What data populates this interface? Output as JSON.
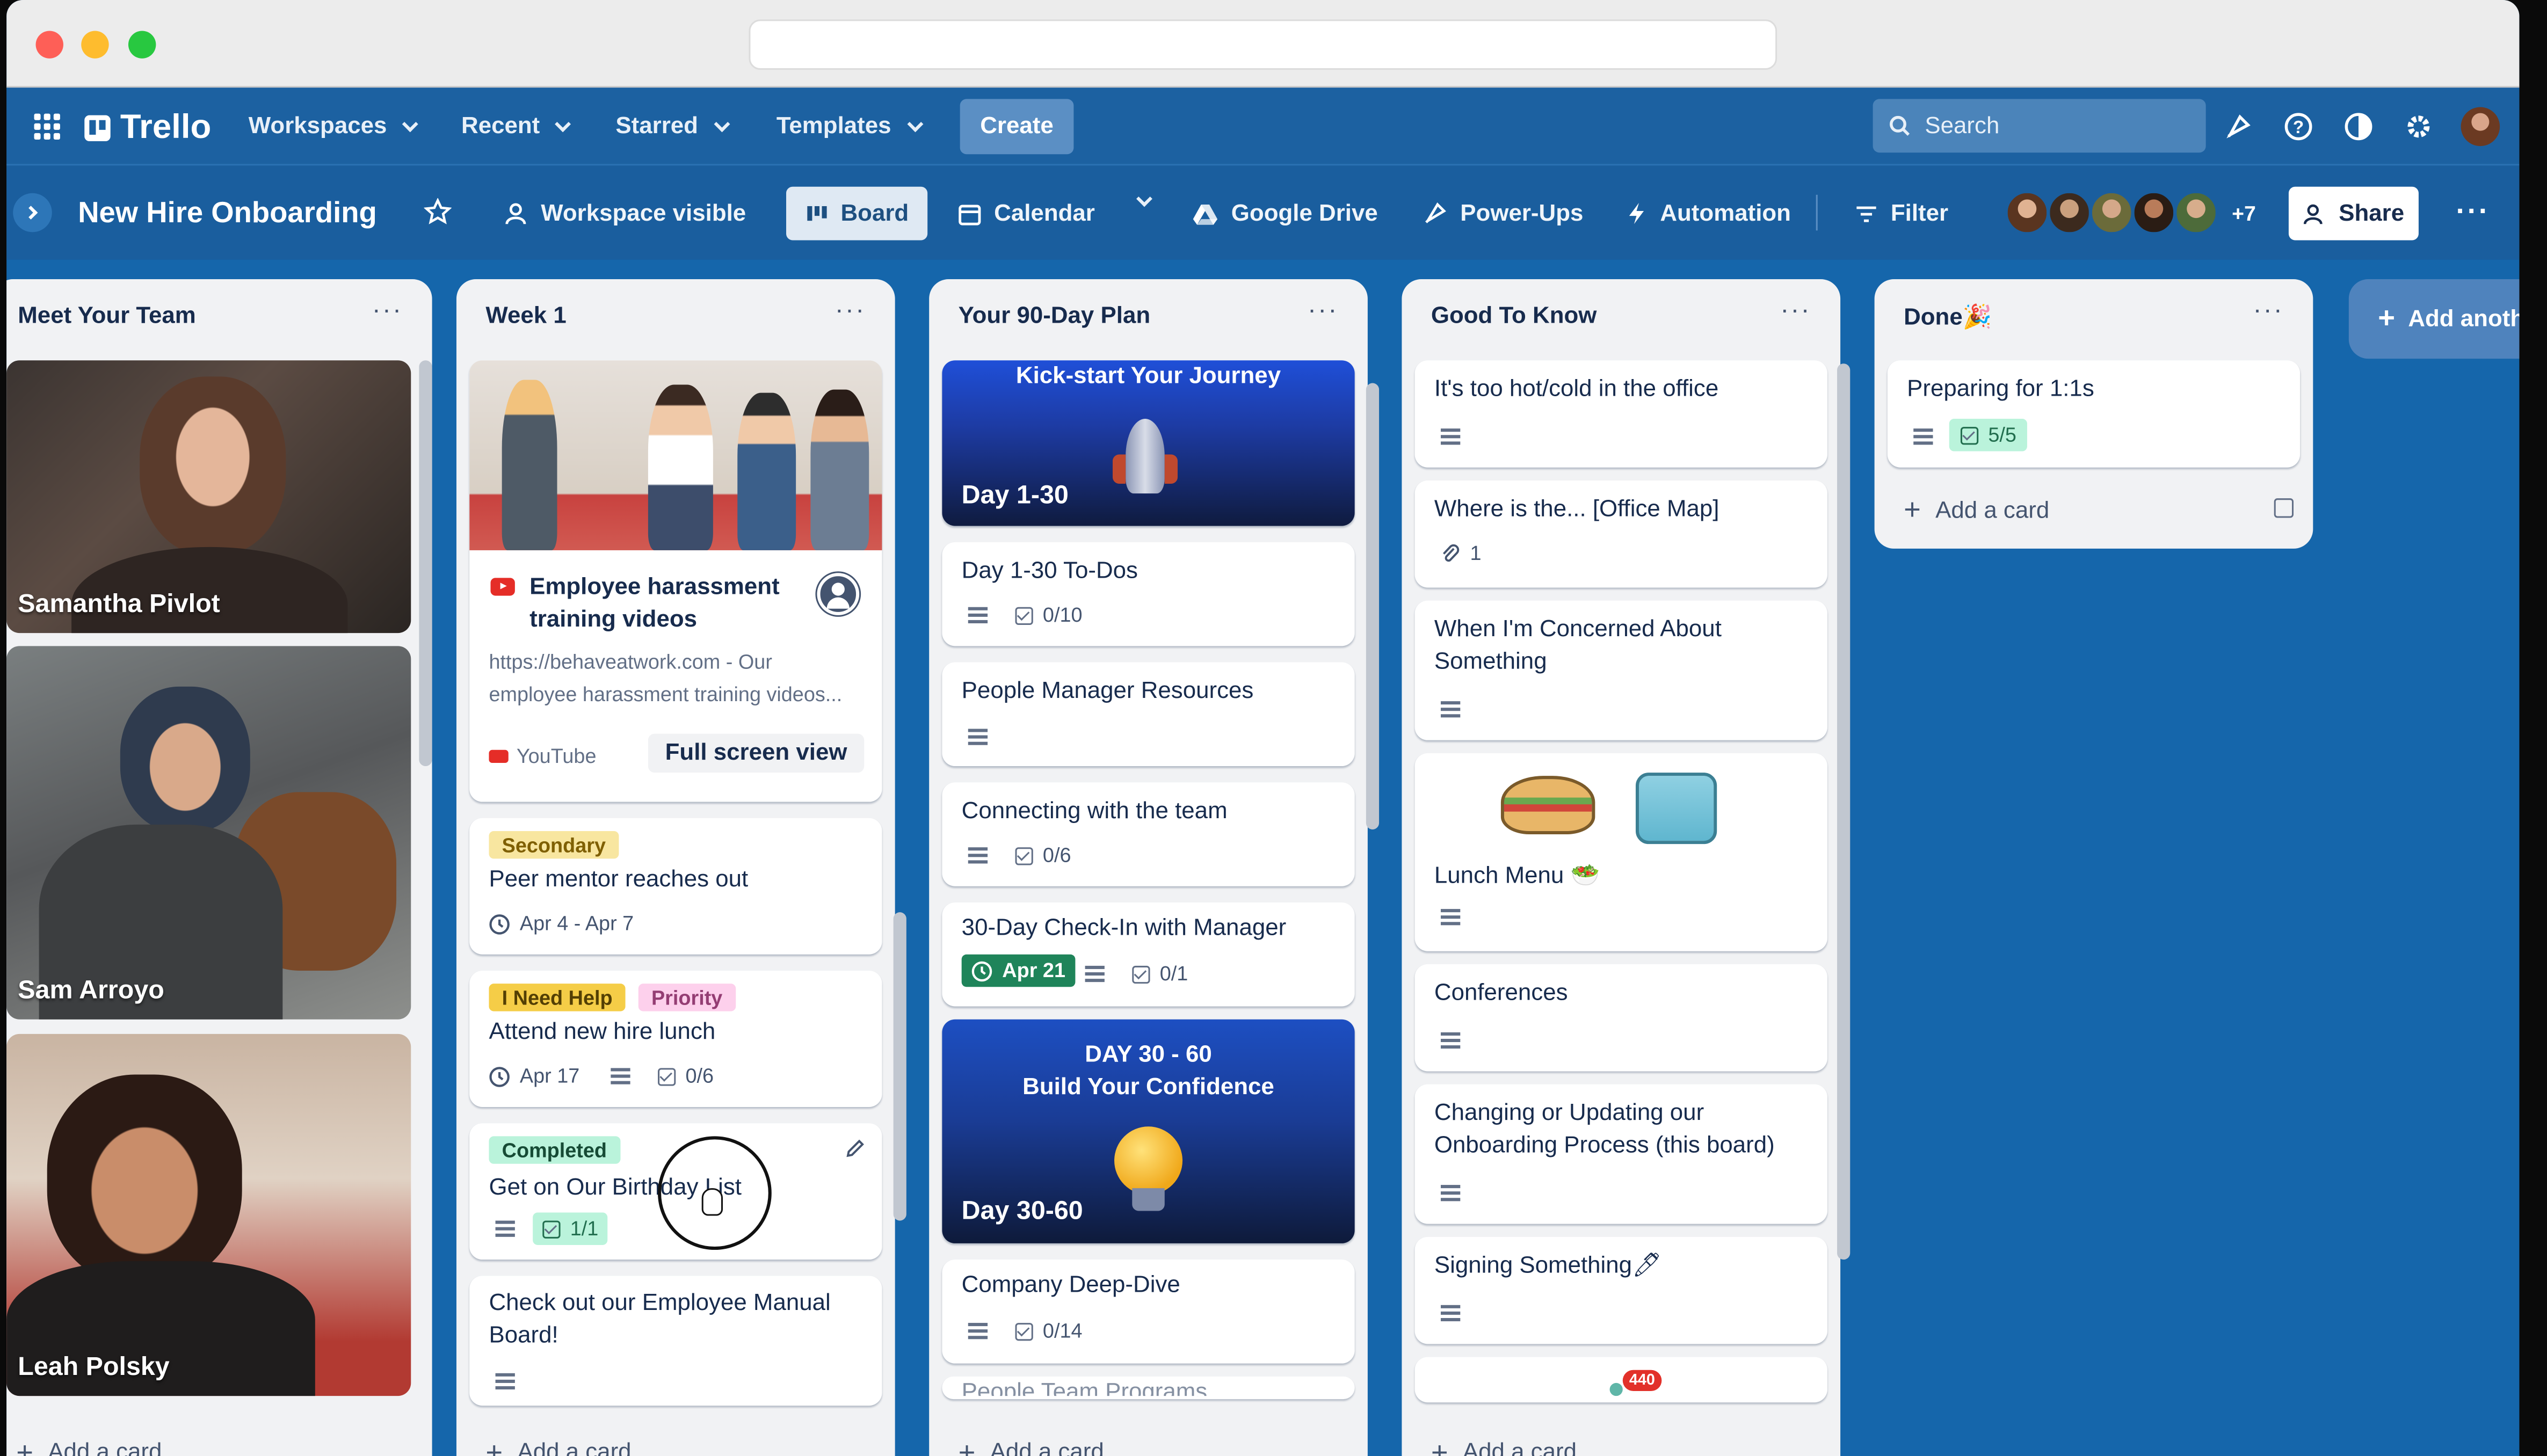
{
  "nav": {
    "brand": "Trello",
    "menus": [
      "Workspaces",
      "Recent",
      "Starred",
      "Templates"
    ],
    "create": "Create",
    "search_placeholder": "Search"
  },
  "board": {
    "title": "New Hire Onboarding",
    "visibility": "Workspace visible",
    "views": [
      "Board",
      "Calendar"
    ],
    "powerups": [
      "Google Drive",
      "Power-Ups",
      "Automation"
    ],
    "filter": "Filter",
    "member_extra": "+7",
    "share": "Share",
    "add_list": "Add anoth"
  },
  "add_card_label": "Add a card",
  "lists": {
    "team": {
      "title": "Meet Your Team",
      "people": [
        "Samantha Pivlot",
        "Sam Arroyo",
        "Leah Polsky"
      ]
    },
    "week1": {
      "title": "Week 1",
      "link_card": {
        "title": "Employee harassment training videos",
        "desc": "https://behaveatwork.com - Our employee harassment training videos...",
        "source": "YouTube",
        "action": "Full screen view"
      },
      "cards": [
        {
          "labels": [
            "Secondary"
          ],
          "title": "Peer mentor reaches out",
          "date": "Apr 4 - Apr 7"
        },
        {
          "labels": [
            "I Need Help",
            "Priority"
          ],
          "title": "Attend new hire lunch",
          "date": "Apr 17",
          "check": "0/6"
        },
        {
          "labels": [
            "Completed"
          ],
          "title": "Get on Our Birthday List",
          "check": "1/1"
        },
        {
          "title": "Check out our Employee Manual Board!"
        }
      ]
    },
    "plan": {
      "title": "Your 90-Day Plan",
      "cover1": {
        "heading": "Kick-start Your Journey",
        "footer": "Day 1-30"
      },
      "cards": [
        {
          "title": "Day 1-30 To-Dos",
          "check": "0/10"
        },
        {
          "title": "People Manager Resources"
        },
        {
          "title": "Connecting with the team",
          "check": "0/6"
        },
        {
          "title": "30-Day Check-In with Manager",
          "date": "Apr 21",
          "check": "0/1"
        },
        {
          "title": "Company Deep-Dive",
          "check": "0/14"
        },
        {
          "title": "People Team Programs"
        }
      ],
      "cover2": {
        "heading1": "DAY 30 - 60",
        "heading2": "Build Your Confidence",
        "footer": "Day 30-60"
      }
    },
    "good": {
      "title": "Good To Know",
      "cards": [
        {
          "title": "It's too hot/cold in the office"
        },
        {
          "title": "Where is the... [Office Map]",
          "attach": "1"
        },
        {
          "title": "When I'm Concerned About Something"
        },
        {
          "title": "Lunch Menu 🥗"
        },
        {
          "title": "Conferences"
        },
        {
          "title": "Changing or Updating our Onboarding Process (this board)"
        },
        {
          "title": "Signing Something🖊"
        }
      ],
      "badge": "440"
    },
    "done": {
      "title": "Done🎉",
      "cards": [
        {
          "title": "Preparing for 1:1s",
          "check": "5/5"
        }
      ]
    }
  },
  "colors": {
    "board_bg": "#1566ab",
    "nav_bg": "#1c61a1",
    "label_secondary": "#f8e6a0",
    "label_help": "#f5cd47",
    "label_priority": "#fdd0ec",
    "label_completed": "#baf3db",
    "due_green": "#1f845a"
  }
}
